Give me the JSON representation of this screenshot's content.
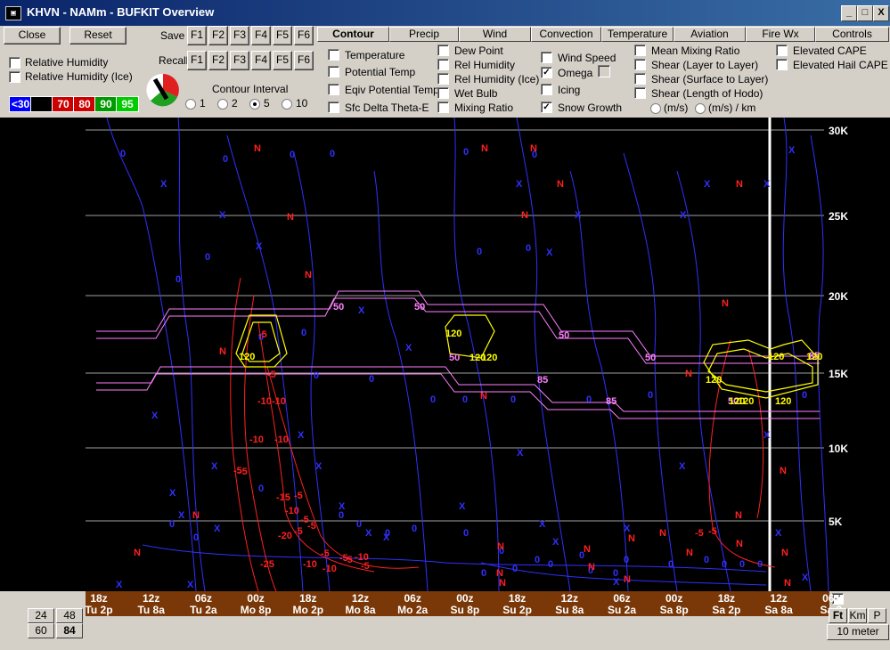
{
  "window": {
    "title": "KHVN - NAMm - BUFKIT Overview",
    "app_icon": "terminal-icon",
    "buttons": {
      "min": "_",
      "max": "□",
      "close": "X"
    }
  },
  "toolbar": {
    "close": "Close",
    "reset": "Reset",
    "save": "Save",
    "recall": "Recall",
    "fkeys": [
      "F1",
      "F2",
      "F3",
      "F4",
      "F5",
      "F6"
    ]
  },
  "left_options": {
    "rh": "Relative Humidity",
    "rh_ice": "Relative Humidity (Ice)"
  },
  "legend": [
    {
      "label": "<30",
      "color": "#0000ff"
    },
    {
      "label": "",
      "color": "#000000"
    },
    {
      "label": "70",
      "color": "#cc0000"
    },
    {
      "label": "80",
      "color": "#cc0000"
    },
    {
      "label": "90",
      "color": "#009900"
    },
    {
      "label": "95",
      "color": "#00cc00"
    }
  ],
  "contour_interval": {
    "label": "Contour Interval",
    "options": [
      "1",
      "2",
      "5",
      "10"
    ],
    "selected": "5"
  },
  "tabs": [
    "Contour",
    "Precip",
    "Wind",
    "Convection",
    "Temperature",
    "Aviation",
    "Fire Wx",
    "Controls"
  ],
  "contour_opts": {
    "col1": [
      "Temperature",
      "Potential Temp",
      "Eqiv Potential Temp",
      "Sfc Delta Theta-E"
    ],
    "col2": [
      "Dew Point",
      "Rel Humidity",
      "Rel Humidity (Ice)",
      "Wet Bulb",
      "Mixing Ratio"
    ],
    "col3": [
      "Wind Speed",
      "Omega",
      "Icing",
      "Snow Growth"
    ],
    "col4": [
      "Mean Mixing Ratio",
      "Shear (Layer to Layer)",
      "Shear (Surface to Layer)",
      "Shear (Length of Hodo)"
    ],
    "units": [
      "(m/s)",
      "(m/s) / km"
    ],
    "col5": [
      "Elevated CAPE",
      "Elevated Hail CAPE"
    ]
  },
  "height_labels": [
    "30K",
    "25K",
    "20K",
    "15K",
    "10K",
    "5K"
  ],
  "time_labels": [
    {
      "t": "18z",
      "d": "Tu 2p"
    },
    {
      "t": "12z",
      "d": "Tu 8a"
    },
    {
      "t": "06z",
      "d": "Tu 2a"
    },
    {
      "t": "00z",
      "d": "Mo 8p"
    },
    {
      "t": "18z",
      "d": "Mo 2p"
    },
    {
      "t": "12z",
      "d": "Mo 8a"
    },
    {
      "t": "06z",
      "d": "Mo 2a"
    },
    {
      "t": "00z",
      "d": "Su 8p"
    },
    {
      "t": "18z",
      "d": "Su 2p"
    },
    {
      "t": "12z",
      "d": "Su 8a"
    },
    {
      "t": "06z",
      "d": "Su 2a"
    },
    {
      "t": "00z",
      "d": "Sa 8p"
    },
    {
      "t": "18z",
      "d": "Sa 2p"
    },
    {
      "t": "12z",
      "d": "Sa 8a"
    },
    {
      "t": "06z",
      "d": "Sa 2"
    }
  ],
  "hours_buttons": [
    "24",
    "48",
    "60",
    "84"
  ],
  "units_buttons": [
    "Ft",
    "Km",
    "P"
  ],
  "level_button": "10 meter",
  "plot_labels": {
    "omega": [
      "0",
      "0",
      "0",
      "0",
      "0",
      "0",
      "0",
      "0",
      "0",
      "0",
      "0",
      "0",
      "0",
      "0",
      "0",
      "0",
      "0",
      "0",
      "0",
      "0",
      "0",
      "0",
      "0",
      "0",
      "0",
      "0",
      "0",
      "0",
      "0",
      "0",
      "0",
      "0",
      "0",
      "0",
      "0",
      "0",
      "0",
      "0",
      "0",
      "0",
      "0",
      "0"
    ],
    "x_marks": [
      "X",
      "X",
      "X",
      "X",
      "X",
      "X",
      "X",
      "X",
      "X",
      "X",
      "X",
      "X",
      "X",
      "X",
      "X",
      "X",
      "X",
      "X",
      "X",
      "X",
      "X",
      "X",
      "X",
      "X",
      "X",
      "X",
      "X",
      "X",
      "X",
      "X",
      "X",
      "X",
      "X",
      "X"
    ],
    "n_marks": [
      "N",
      "N",
      "N",
      "N",
      "N",
      "N",
      "N",
      "N",
      "N",
      "N",
      "N",
      "N",
      "N",
      "N",
      "N",
      "N",
      "N",
      "N",
      "N",
      "N",
      "N",
      "N",
      "N",
      "N",
      "N",
      "N",
      "N",
      "N"
    ],
    "red_vals": [
      "-5",
      "-5",
      "-10",
      "-10",
      "-5",
      "-10",
      "-10",
      "-5",
      "-15",
      "-5",
      "-10",
      "-5",
      "-20",
      "-5",
      "-5",
      "-25",
      "-5",
      "-10",
      "-10",
      "-5",
      "-5",
      "-10",
      "-5",
      "-5",
      "-5"
    ],
    "pink_vals": [
      "50",
      "50",
      "50",
      "50",
      "50",
      "85",
      "85",
      "50",
      "85"
    ],
    "yellow_vals": [
      "120",
      "120",
      "120",
      "120",
      "120",
      "120",
      "120",
      "120",
      "120",
      "120"
    ]
  }
}
